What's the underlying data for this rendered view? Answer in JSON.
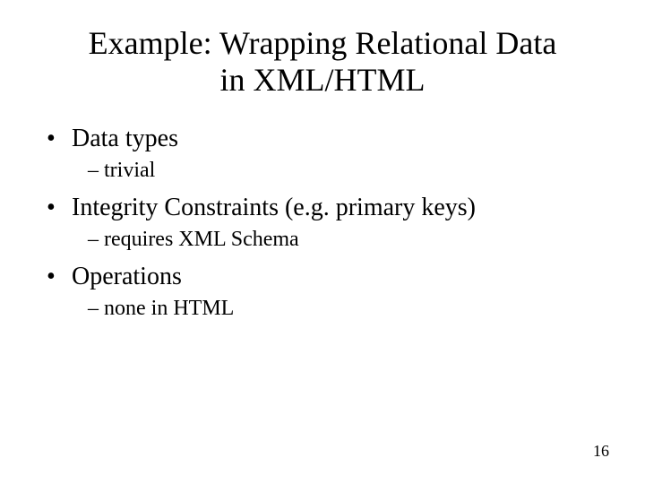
{
  "title_line1": "Example: Wrapping Relational Data",
  "title_line2": "in XML/HTML",
  "items": {
    "0": {
      "text": "Data types",
      "sub": "trivial"
    },
    "1": {
      "text": "Integrity Constraints (e.g. primary keys)",
      "sub": "requires XML Schema"
    },
    "2": {
      "text": "Operations",
      "sub": "none in HTML"
    }
  },
  "bullet_char": "•",
  "dash_char": "–",
  "page_number": "16"
}
